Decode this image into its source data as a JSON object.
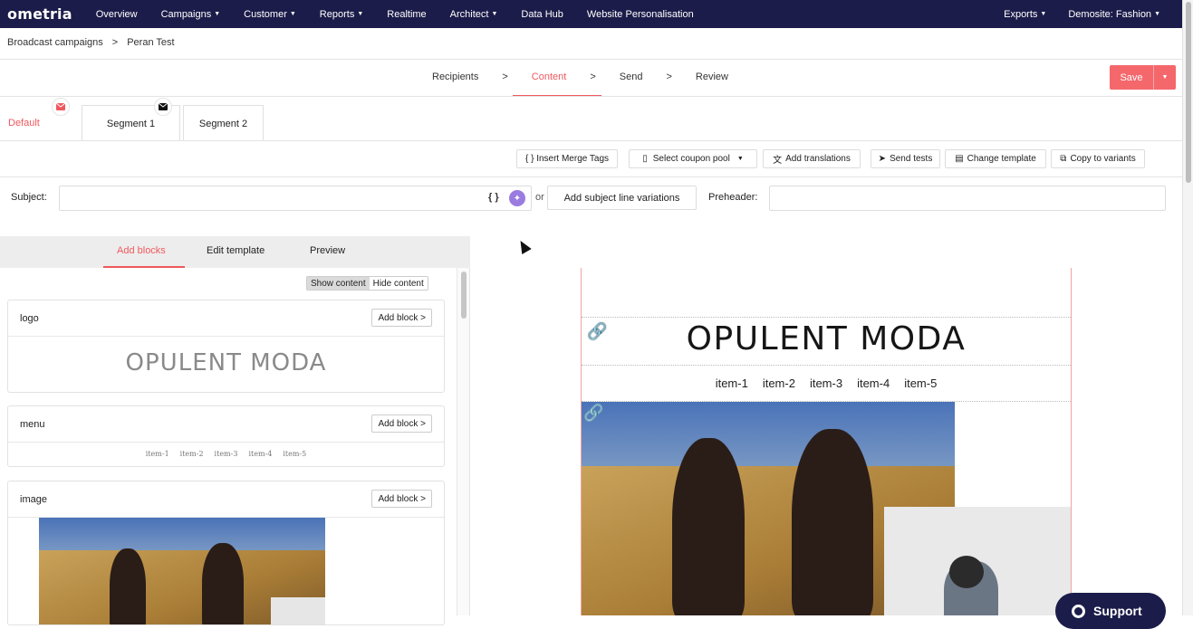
{
  "nav": {
    "logo_main": "ometria",
    "items": [
      "Overview",
      "Campaigns",
      "Customer",
      "Reports",
      "Realtime",
      "Architect",
      "Data Hub",
      "Website Personalisation"
    ],
    "right": [
      "Exports",
      "Demosite: Fashion"
    ]
  },
  "breadcrumb": {
    "parent": "Broadcast campaigns",
    "sep": ">",
    "current": "Peran Test"
  },
  "steps": [
    "Recipients",
    ">",
    "Content",
    ">",
    "Send",
    ">",
    "Review"
  ],
  "save_label": "Save",
  "variant_tabs": [
    "Default",
    "Segment 1",
    "Segment 2"
  ],
  "toolbar": {
    "merge": "{ } Insert Merge Tags",
    "coupon": "Select coupon pool",
    "translations": "Add translations",
    "send_tests": "Send tests",
    "change_template": "Change template",
    "copy_variants": "Copy to variants"
  },
  "subject": {
    "label": "Subject:",
    "value": "",
    "merge_icon": "{ }",
    "or": "or",
    "variations_button": "Add subject line variations"
  },
  "preheader": {
    "label": "Preheader:",
    "value": ""
  },
  "left_panel": {
    "tabs": [
      "Add blocks",
      "Edit template",
      "Preview"
    ],
    "show_content": "Show content",
    "hide_content": "Hide content",
    "blocks": [
      {
        "title": "logo",
        "button": "Add block >",
        "preview": "OPULENT MODA"
      },
      {
        "title": "menu",
        "button": "Add block >",
        "items": [
          "item-1",
          "item-2",
          "item-3",
          "item-4",
          "item-5"
        ]
      },
      {
        "title": "image",
        "button": "Add block >"
      }
    ]
  },
  "email_preview": {
    "logo": "OPULENT MODA",
    "menu": [
      "item-1",
      "item-2",
      "item-3",
      "item-4",
      "item-5"
    ]
  },
  "support_label": "Support",
  "colors": {
    "accent": "#f0585e",
    "nav_bg": "#1c1c4a",
    "save": "#f4686c"
  }
}
